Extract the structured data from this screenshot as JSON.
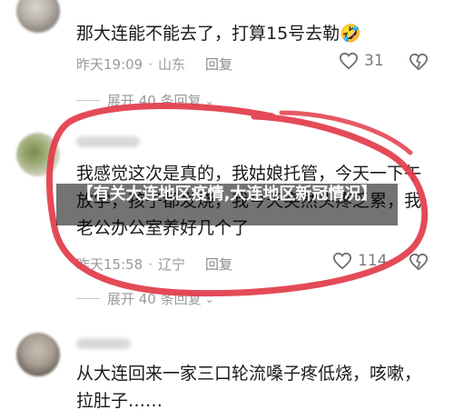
{
  "comments": [
    {
      "text": "那大连能不能去了，打算15号去勒🤣",
      "time": "昨天19:09",
      "location": "山东",
      "reply": "回复",
      "likes": "31"
    },
    {
      "text": "我感觉这次是真的，我姑娘托管，今天一下午放学，孩子都发烧，我今天突然头疼乏累，我老公办公室养好几个了",
      "time": "昨天15:58",
      "location": "辽宁",
      "reply": "回复",
      "likes": "114"
    },
    {
      "text": "从大连回来一家三口轮流嗓子疼低烧，咳嗽，拉肚子……"
    }
  ],
  "expand_label": "展开 40 条回复",
  "caption": "【有关大连地区疫情,大连地区新冠情况】",
  "colors": {
    "highlight_circle": "#e23b4a",
    "meta": "#9a9a9a"
  },
  "icons": [
    "heart-icon",
    "dislike-heart-icon",
    "chevron-down-icon"
  ]
}
